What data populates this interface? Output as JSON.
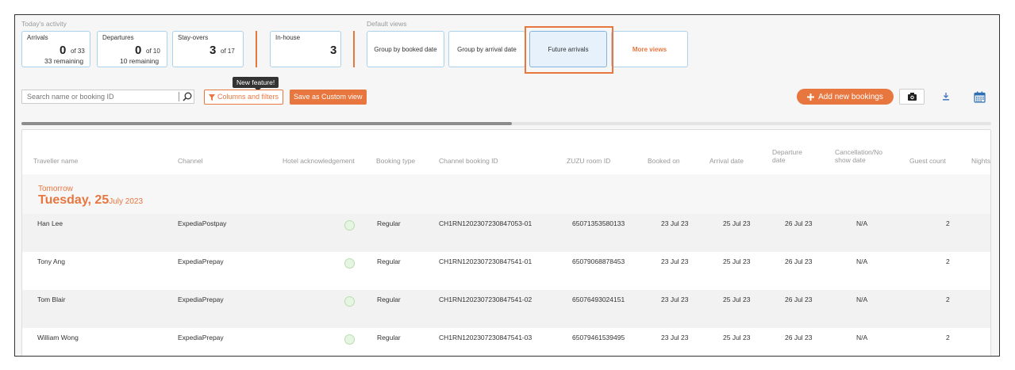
{
  "activity": {
    "section_label": "Today's activity",
    "arrivals": {
      "title": "Arrivals",
      "count": "0",
      "of": "of 33",
      "remaining": "33 remaining"
    },
    "departures": {
      "title": "Departures",
      "count": "0",
      "of": "of 10",
      "remaining": "10 remaining"
    },
    "stayovers": {
      "title": "Stay-overs",
      "count": "3",
      "of": "of 17"
    },
    "inhouse": {
      "title": "In-house",
      "count": "3"
    }
  },
  "views": {
    "section_label": "Default views",
    "items": [
      {
        "label": "Group by booked date"
      },
      {
        "label": "Group by arrival date"
      },
      {
        "label": "Future arrivals",
        "active": true
      },
      {
        "label": "More views"
      }
    ]
  },
  "toolbar": {
    "search_placeholder": "Search name or booking ID",
    "tooltip": "New feature!",
    "columns_filters_label": "Columns and filters",
    "save_custom_label": "Save as Custom view",
    "add_bookings_label": "Add new bookings"
  },
  "icons": {
    "search": "search-icon",
    "filter": "filter-icon",
    "plus": "plus-icon",
    "camera": "camera-icon",
    "download": "download-icon",
    "calendar": "calendar-icon"
  },
  "colors": {
    "accent": "#e8763f",
    "card_border": "#aad2ea",
    "active_view_bg": "#e6f1fb"
  },
  "table": {
    "columns": [
      "Traveller name",
      "Channel",
      "Hotel acknowledgement",
      "Booking type",
      "Channel booking ID",
      "ZUZU room ID",
      "Booked on",
      "Arrival date",
      "Departure date",
      "Cancellation/No show date",
      "Guest count",
      "Nights"
    ],
    "group": {
      "relative": "Tomorrow",
      "day": "Tuesday, 25",
      "month_year": "July 2023"
    },
    "rows": [
      {
        "name": "Han Lee",
        "channel": "ExpediaPostpay",
        "type": "Regular",
        "channel_id": "CH1RN1202307230847053-01",
        "room_id": "65071353580133",
        "booked_on": "23 Jul 23",
        "arrival": "25 Jul 23",
        "departure": "26 Jul 23",
        "cancel": "N/A",
        "guests": "2"
      },
      {
        "name": "Tony Ang",
        "channel": "ExpediaPrepay",
        "type": "Regular",
        "channel_id": "CH1RN1202307230847541-01",
        "room_id": "65079068878453",
        "booked_on": "23 Jul 23",
        "arrival": "25 Jul 23",
        "departure": "26 Jul 23",
        "cancel": "N/A",
        "guests": "2"
      },
      {
        "name": "Tom Blair",
        "channel": "ExpediaPrepay",
        "type": "Regular",
        "channel_id": "CH1RN1202307230847541-02",
        "room_id": "65076493024151",
        "booked_on": "23 Jul 23",
        "arrival": "25 Jul 23",
        "departure": "26 Jul 23",
        "cancel": "N/A",
        "guests": "2"
      },
      {
        "name": "William Wong",
        "channel": "ExpediaPrepay",
        "type": "Regular",
        "channel_id": "CH1RN1202307230847541-03",
        "room_id": "65079461539495",
        "booked_on": "23 Jul 23",
        "arrival": "25 Jul 23",
        "departure": "26 Jul 23",
        "cancel": "N/A",
        "guests": "2"
      }
    ]
  }
}
